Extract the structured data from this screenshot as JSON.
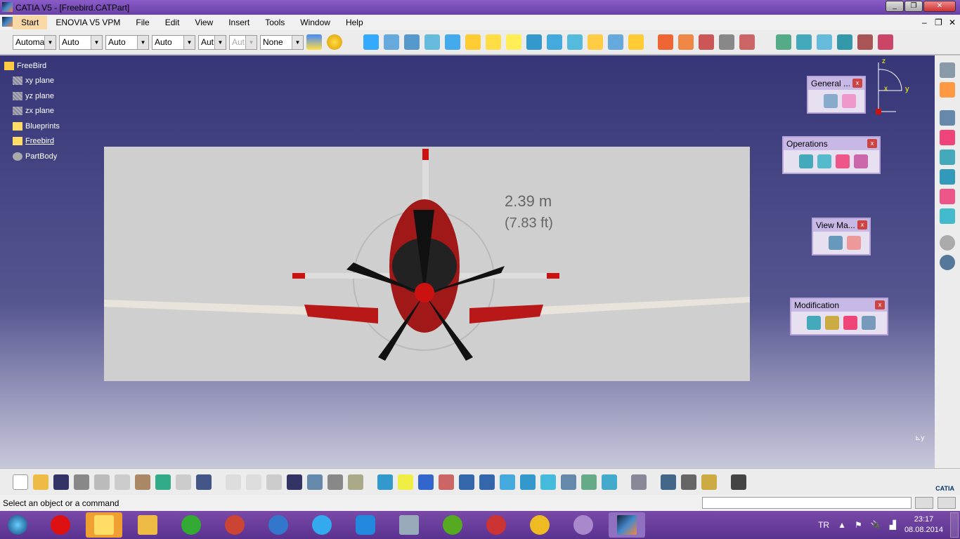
{
  "window": {
    "title": "CATIA V5 - [Freebird.CATPart]"
  },
  "menu": [
    "Start",
    "ENOVIA V5 VPM",
    "File",
    "Edit",
    "View",
    "Insert",
    "Tools",
    "Window",
    "Help"
  ],
  "toolbar": {
    "combos": [
      "Automa",
      "Auto",
      "Auto",
      "Auto",
      "Aut",
      "Aut",
      "None"
    ]
  },
  "tree": {
    "root": "FreeBird",
    "items": [
      "xy plane",
      "yz plane",
      "zx plane",
      "Blueprints",
      "Freebird",
      "PartBody"
    ]
  },
  "panels": {
    "general": "General ...",
    "operations": "Operations",
    "view": "View Ma...",
    "modification": "Modification",
    "close": "x"
  },
  "image": {
    "dim1": "2.39 m",
    "dim2": "(7.83 ft)"
  },
  "axis": {
    "x": "x",
    "y": "y",
    "z": "z"
  },
  "brand": "CATIA",
  "status": {
    "message": "Select an object or a command"
  },
  "tray": {
    "lang": "TR",
    "time": "23:17",
    "date": "08.08.2014"
  }
}
